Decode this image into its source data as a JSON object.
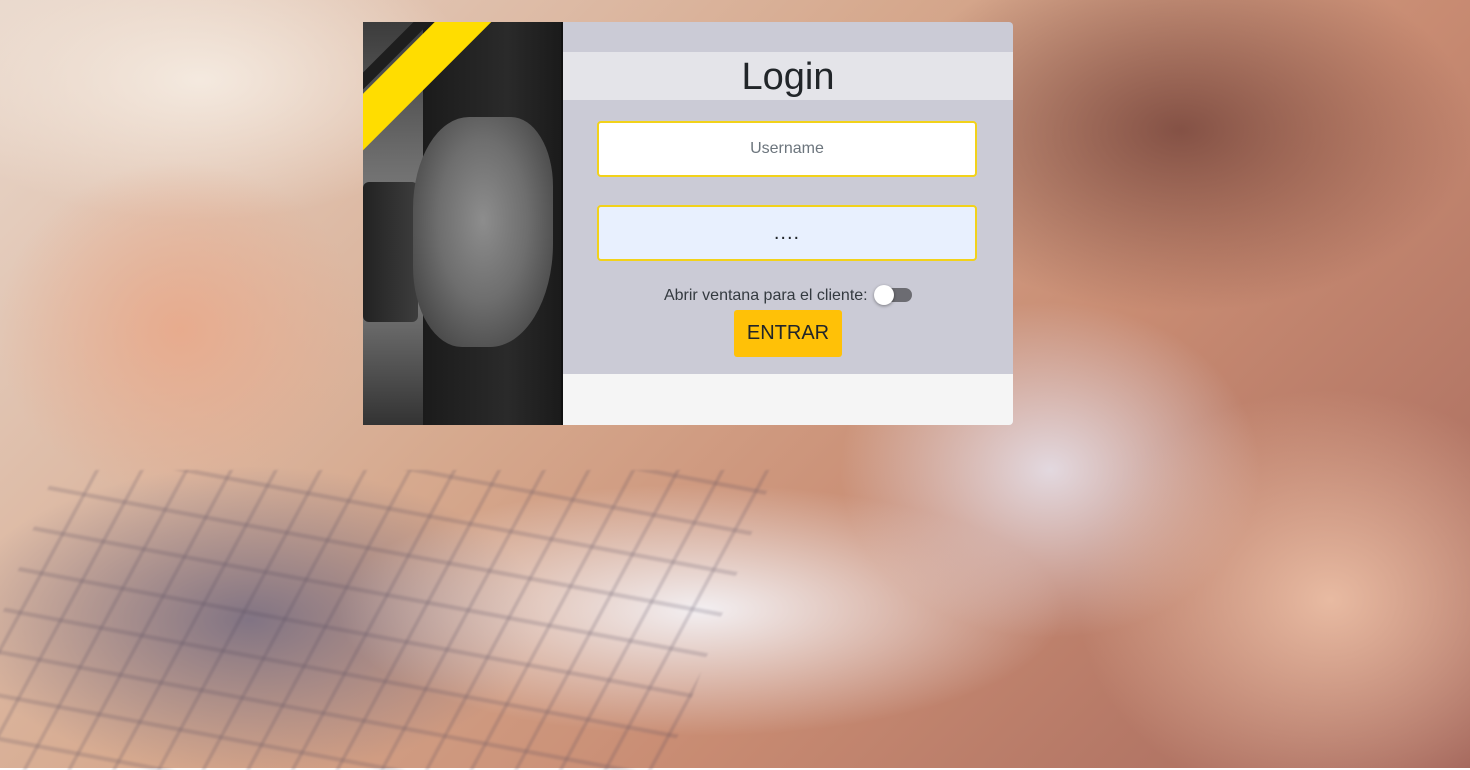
{
  "login": {
    "title": "Login",
    "username_placeholder": "Username",
    "username_value": "",
    "password_value": "....",
    "toggle_label": "Abrir ventana para el cliente:",
    "toggle_state": "off",
    "submit_label": "ENTRAR"
  },
  "colors": {
    "accent": "#ffc107",
    "field_border": "#f2d21a",
    "panel_bg": "#cbcbd6",
    "header_bg": "#e4e4e9",
    "password_bg": "#e8f0fe",
    "stripe_yellow": "#ffdd00"
  },
  "images": {
    "background": "blurred-photo-hands-typing-laptop-holding-phone",
    "side_panel": "grayscale-worker-hand-holding-tool"
  }
}
